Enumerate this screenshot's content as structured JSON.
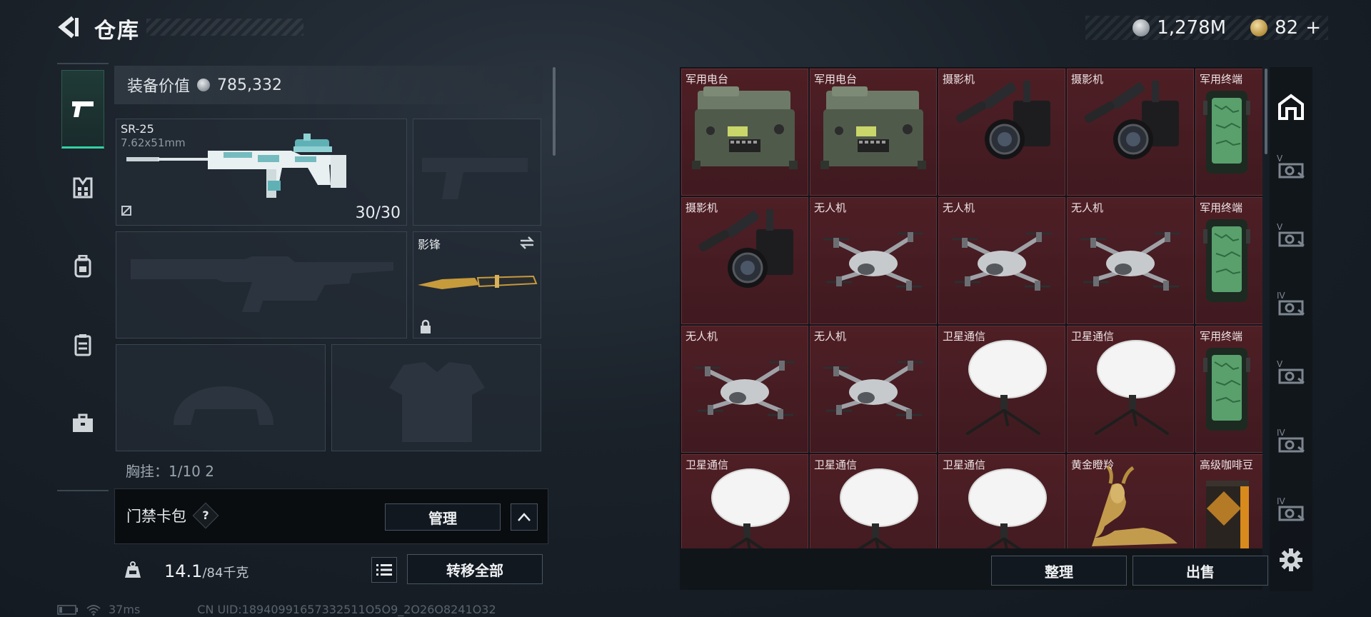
{
  "header": {
    "title": "仓库",
    "silver_value": "1,278M",
    "gold_value": "82",
    "gold_add": "+"
  },
  "left_nav": {
    "items": [
      {
        "icon": "pistol-icon",
        "active": true
      },
      {
        "icon": "vest-icon",
        "active": false
      },
      {
        "icon": "backpack-icon",
        "active": false
      },
      {
        "icon": "rig-icon",
        "active": false
      },
      {
        "icon": "case-icon",
        "active": false
      }
    ]
  },
  "loadout": {
    "equip_value_label": "装备价值",
    "equip_value": "785,332",
    "primary": {
      "name": "SR-25",
      "caliber": "7.62x51mm",
      "ammo": "30/30"
    },
    "melee": {
      "name": "影锋"
    },
    "chest_line": "胸挂：1/10 2"
  },
  "card_bar": {
    "label": "门禁卡包",
    "help": "?",
    "manage_label": "管理"
  },
  "bottom_left": {
    "weight_current": "14.1",
    "weight_max": "/84千克",
    "transfer_all_label": "转移全部"
  },
  "status": {
    "ping": "37ms",
    "uid": "CN UID:18940991657332511O5O9_2O26O8241O32"
  },
  "storage": {
    "rows": [
      [
        {
          "label": "军用电台",
          "icon": "radio-icon"
        },
        {
          "label": "军用电台",
          "icon": "radio-icon"
        },
        {
          "label": "摄影机",
          "icon": "camera-icon"
        },
        {
          "label": "摄影机",
          "icon": "camera-icon"
        },
        {
          "label": "军用终端",
          "icon": "terminal-icon"
        }
      ],
      [
        {
          "label": "摄影机",
          "icon": "camera-icon"
        },
        {
          "label": "无人机",
          "icon": "drone-icon"
        },
        {
          "label": "无人机",
          "icon": "drone-icon"
        },
        {
          "label": "无人机",
          "icon": "drone-icon"
        },
        {
          "label": "军用终端",
          "icon": "terminal-icon"
        }
      ],
      [
        {
          "label": "无人机",
          "icon": "drone-icon"
        },
        {
          "label": "无人机",
          "icon": "drone-icon"
        },
        {
          "label": "卫星通信",
          "icon": "satellite-dish-icon"
        },
        {
          "label": "卫星通信",
          "icon": "satellite-dish-icon"
        },
        {
          "label": "军用终端",
          "icon": "terminal-icon"
        }
      ],
      [
        {
          "label": "卫星通信",
          "icon": "satellite-dish-icon"
        },
        {
          "label": "卫星通信",
          "icon": "satellite-dish-icon"
        },
        {
          "label": "卫星通信",
          "icon": "satellite-dish-icon"
        },
        {
          "label": "黄金瞪羚",
          "icon": "gold-gazelle-icon"
        },
        {
          "label": "高级咖啡豆",
          "icon": "coffee-bag-icon"
        }
      ]
    ],
    "sort_label": "整理",
    "sell_label": "出售"
  },
  "right_tabs": {
    "items": [
      {
        "icon": "warehouse-icon"
      },
      {
        "icon": "tier-v-icon",
        "tier": "V"
      },
      {
        "icon": "tier-v-icon",
        "tier": "V"
      },
      {
        "icon": "tier-iv-icon",
        "tier": "IV"
      },
      {
        "icon": "tier-v-icon",
        "tier": "V"
      },
      {
        "icon": "tier-iv-icon",
        "tier": "IV"
      },
      {
        "icon": "tier-iv-icon",
        "tier": "IV"
      }
    ],
    "settings_icon": "gear-icon"
  },
  "colors": {
    "accent_green": "#34d1a4",
    "cell_red": "#4e1f25",
    "panel_dark": "#10151a"
  }
}
